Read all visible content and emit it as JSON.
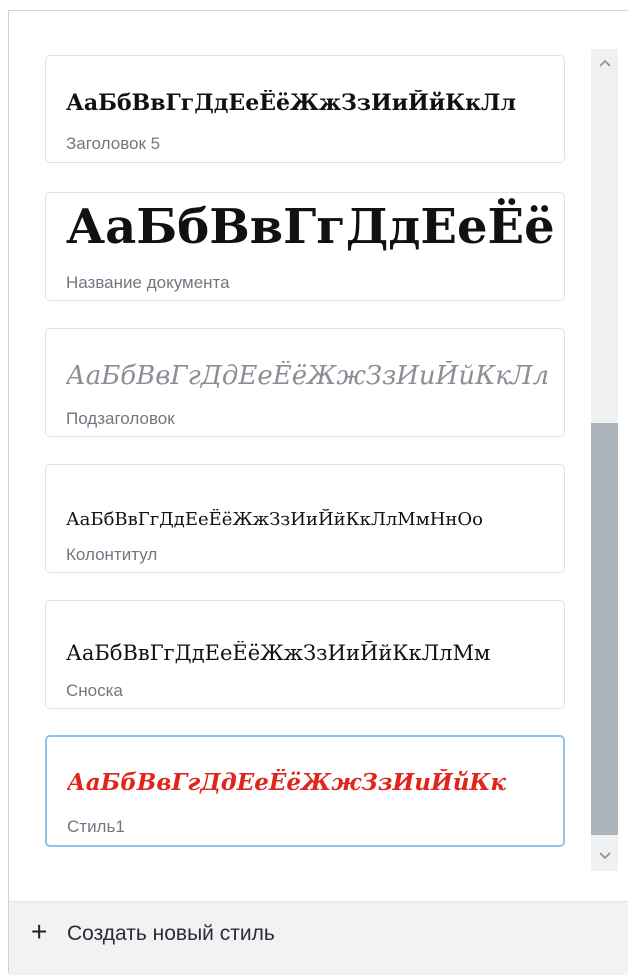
{
  "styles": [
    {
      "preview": "АаБбВвГгДдЕеЁёЖжЗзИиЙйКкЛл",
      "label": "Заголовок 5"
    },
    {
      "preview": "АаБбВвГгДдЕеЁё",
      "label": "Название документа"
    },
    {
      "preview": "АаБбВвГгДдЕеЁёЖжЗзИиЙйКкЛл",
      "label": "Подзаголовок"
    },
    {
      "preview": "АаБбВвГгДдЕеЁёЖжЗзИиЙйКкЛлМмНнОо",
      "label": "Колонтитул"
    },
    {
      "preview": "АаБбВвГгДдЕеЁёЖжЗзИиЙйКкЛлМм",
      "label": "Сноска"
    },
    {
      "preview": "АаБбВвГгДдЕеЁёЖжЗзИиЙйКк",
      "label": "Стиль1",
      "selected": true,
      "color": "#e0261c"
    }
  ],
  "footer": {
    "plus_icon": "plus-icon",
    "create_label": "Создать новый стиль"
  },
  "scrollbar": {
    "up_icon": "chevron-up-icon",
    "down_icon": "chevron-down-icon"
  }
}
